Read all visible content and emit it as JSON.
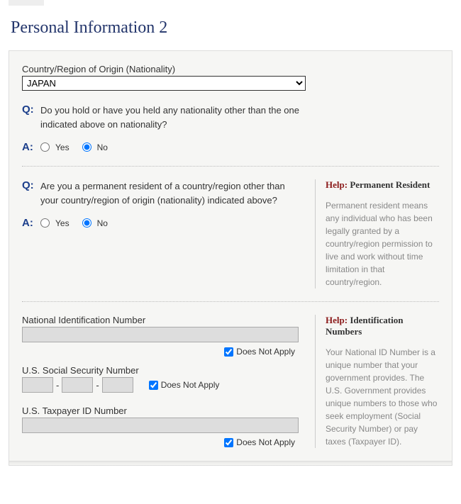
{
  "page": {
    "title": "Personal Information 2"
  },
  "nationality": {
    "label": "Country/Region of Origin (Nationality)",
    "value": "JAPAN"
  },
  "qa": {
    "q_prefix": "Q:",
    "a_prefix": "A:"
  },
  "answers": {
    "yes": "Yes",
    "no": "No"
  },
  "q1": {
    "question": "Do you hold or have you held any nationality other than the one indicated above on nationality?"
  },
  "q2": {
    "question": "Are you a permanent resident of a country/region other than your country/region of origin (nationality) indicated above?"
  },
  "help1": {
    "label": "Help:",
    "topic": "Permanent Resident",
    "body": "Permanent resident means any individual who has been legally granted by a country/region permission to live and work without time limitation in that country/region."
  },
  "ids": {
    "nin_label": "National Identification Number",
    "ssn_label": "U.S. Social Security Number",
    "tin_label": "U.S. Taxpayer ID Number",
    "dna": "Does Not Apply"
  },
  "help2": {
    "label": "Help:",
    "topic": "Identification Numbers",
    "body": "Your National ID Number is a unique number that your government provides. The U.S. Government provides unique numbers to those who seek employment (Social Security Number) or pay taxes (Taxpayer ID)."
  }
}
